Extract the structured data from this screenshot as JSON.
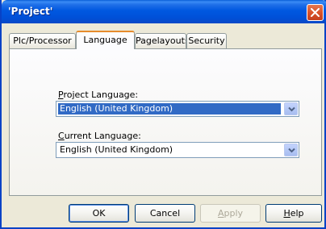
{
  "window": {
    "title": "'Project'"
  },
  "tabs": [
    {
      "label": "Plc/Processor",
      "active": false
    },
    {
      "label": "Language",
      "active": true
    },
    {
      "label": "Pagelayouts",
      "active": false
    },
    {
      "label": "Security",
      "active": false
    }
  ],
  "project_language": {
    "label_accel": "P",
    "label_rest": "roject Language:",
    "value": "English (United Kingdom)"
  },
  "current_language": {
    "label_accel": "C",
    "label_rest": "urrent Language:",
    "value": "English (United Kingdom)"
  },
  "buttons": {
    "ok": "OK",
    "cancel": "Cancel",
    "apply_accel": "A",
    "apply_rest": "pply",
    "help_accel": "H",
    "help_rest": "elp"
  },
  "colors": {
    "titlebar": "#0058e0",
    "selection": "#316ac5",
    "active_tab_accent": "#e68b2c",
    "close_button": "#d9532b"
  },
  "icons": {
    "close": "close-icon",
    "dropdown": "chevron-down-icon"
  }
}
